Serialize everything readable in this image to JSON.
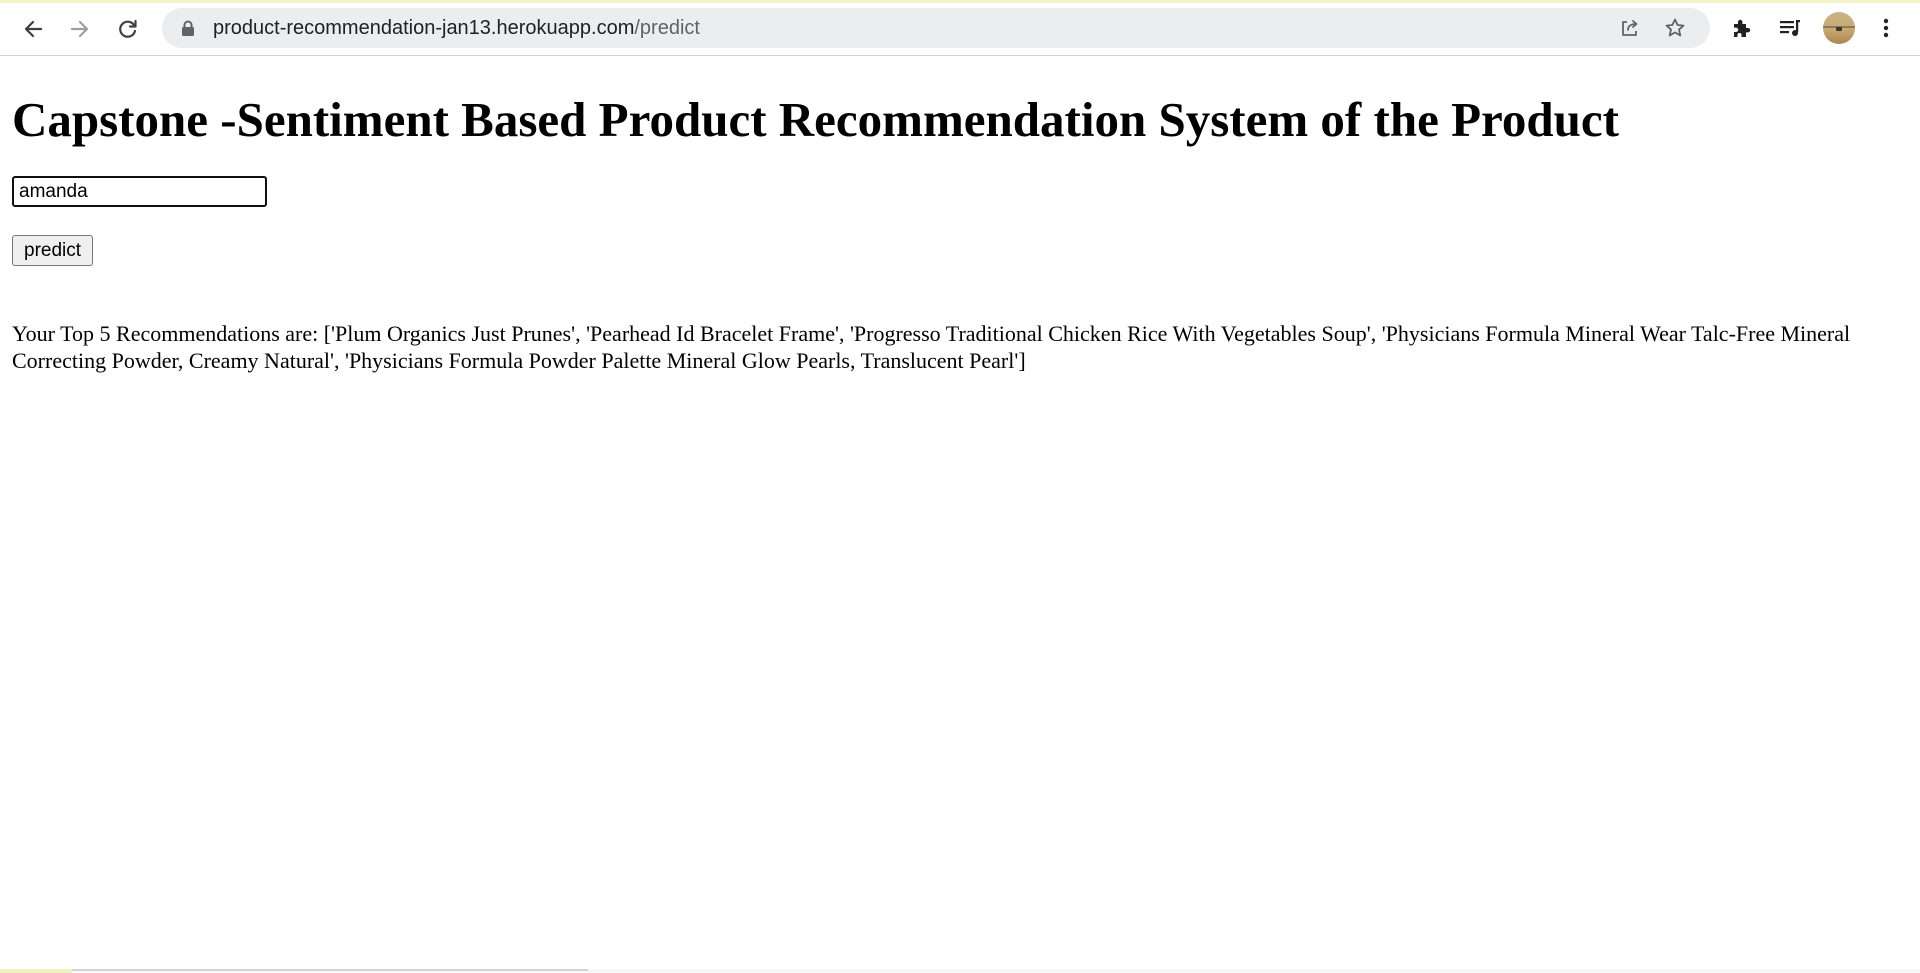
{
  "browser": {
    "url_host": "product-recommendation-jan13.herokuapp.com",
    "url_path": "/predict",
    "icons": {
      "back": "back-arrow-icon",
      "forward": "forward-arrow-icon",
      "reload": "reload-icon",
      "lock": "lock-icon",
      "share": "share-icon",
      "bookmark": "star-icon",
      "extensions": "puzzle-icon",
      "media": "media-queue-icon",
      "menu": "kebab-menu-icon"
    }
  },
  "page": {
    "title": "Capstone -Sentiment Based Product Recommendation System of the Product",
    "username_value": "amanda",
    "predict_label": "predict",
    "result_text": "Your Top 5 Recommendations are: ['Plum Organics Just Prunes', 'Pearhead Id Bracelet Frame', 'Progresso Traditional Chicken Rice With Vegetables Soup', 'Physicians Formula Mineral Wear Talc-Free Mineral Correcting Powder, Creamy Natural', 'Physicians Formula Powder Palette Mineral Glow Pearls, Translucent Pearl']"
  },
  "colors": {
    "toolbar_bg": "#ffffff",
    "omnibox_bg": "#ecedef",
    "url_host": "#202124",
    "url_path": "#5f6368",
    "page_bg": "#ffffff"
  }
}
